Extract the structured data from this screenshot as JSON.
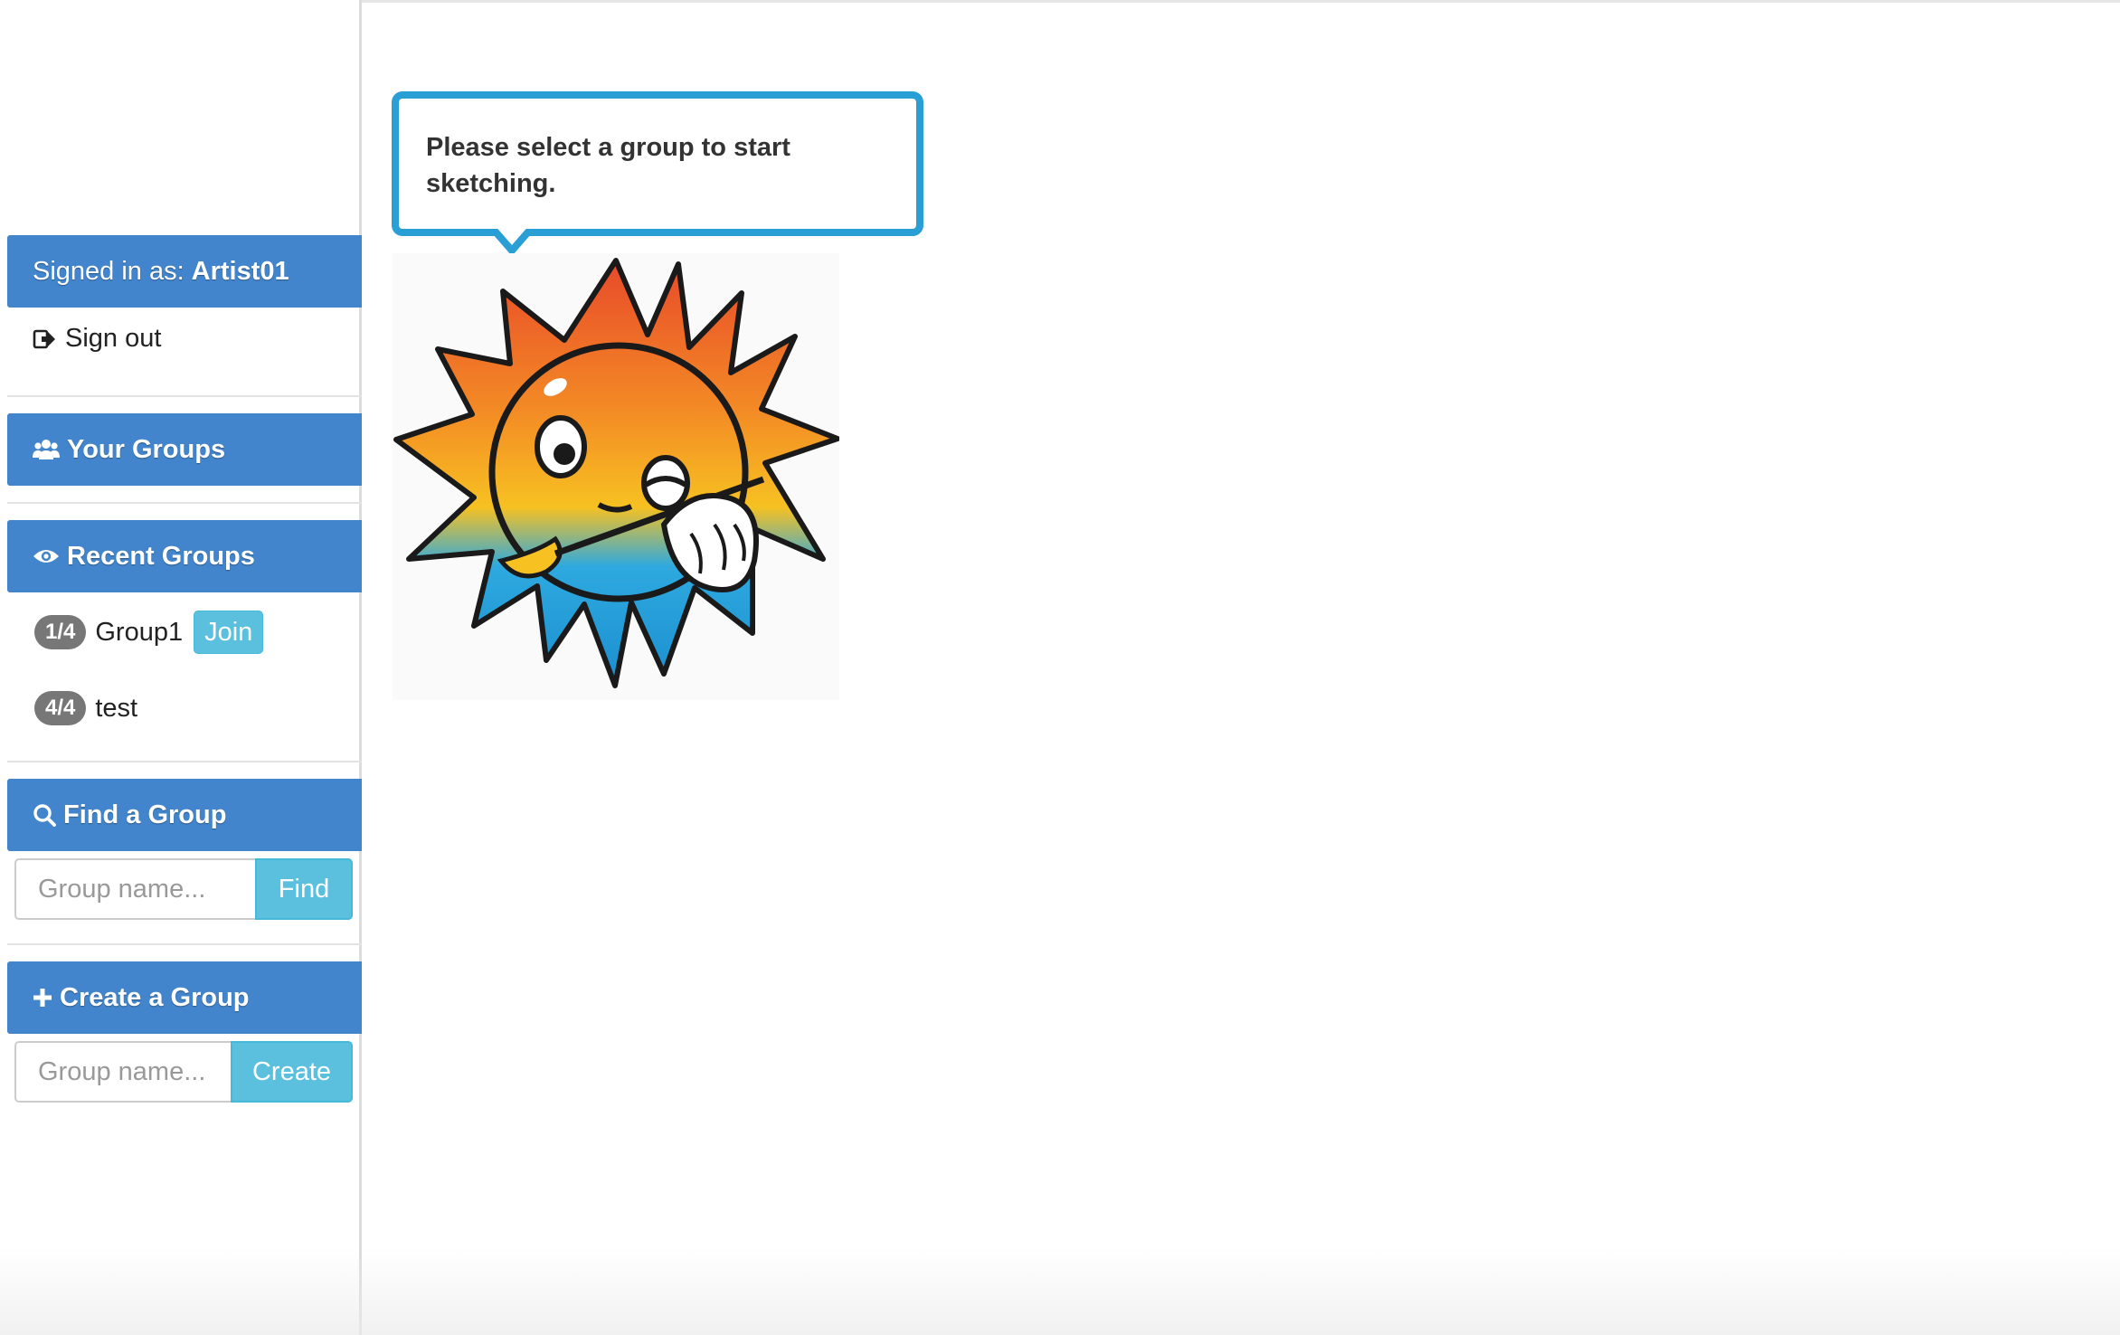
{
  "account": {
    "signed_in_prefix": "Signed in as:",
    "username": "Artist01",
    "sign_out_label": "Sign out"
  },
  "sections": {
    "your_groups": "Your Groups",
    "recent_groups": "Recent Groups",
    "find_group": "Find a Group",
    "create_group": "Create a Group"
  },
  "recent_groups": [
    {
      "count": "1/4",
      "name": "Group1",
      "action": "Join"
    },
    {
      "count": "4/4",
      "name": "test"
    }
  ],
  "find": {
    "placeholder": "Group name...",
    "button": "Find"
  },
  "create": {
    "placeholder": "Group name...",
    "button": "Create"
  },
  "main": {
    "message": "Please select a group to start sketching."
  },
  "colors": {
    "panel_blue": "#4285cc",
    "info_blue": "#5bc0de",
    "bubble_border": "#2a9fd6",
    "badge_gray": "#777777"
  }
}
